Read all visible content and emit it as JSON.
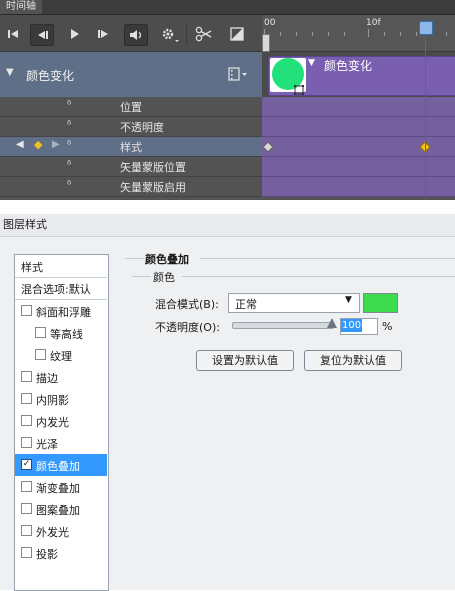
{
  "timeline": {
    "tab_title": "时间轴",
    "ruler": {
      "start_label": "00",
      "mark_label": "10f"
    },
    "layer": {
      "name": "颜色变化",
      "clip_name": "颜色变化"
    },
    "properties": [
      {
        "label": "位置"
      },
      {
        "label": "不透明度"
      },
      {
        "label": "样式"
      },
      {
        "label": "矢量蒙版位置"
      },
      {
        "label": "矢量蒙版启用"
      }
    ],
    "controls": {
      "first_frame_icon": "skip-to-first-icon",
      "prev_frame_icon": "previous-frame-icon",
      "play_icon": "play-icon",
      "next_frame_icon": "next-frame-icon",
      "audio_icon": "speaker-icon",
      "settings_icon": "gear-icon",
      "split_icon": "scissors-icon",
      "transition_icon": "transition-icon"
    },
    "colors": {
      "clip": "#7a5fb0",
      "playhead": "#e0302a",
      "keyframe": "#f0c020",
      "clip_thumb_circle": "#22e07a"
    }
  },
  "dialog": {
    "title": "图层样式",
    "left_panel": {
      "header": "样式",
      "blend_options": "混合选项:默认",
      "items": [
        {
          "label": "斜面和浮雕",
          "checked": false,
          "indent": false
        },
        {
          "label": "等高线",
          "checked": false,
          "indent": true
        },
        {
          "label": "纹理",
          "checked": false,
          "indent": true
        },
        {
          "label": "描边",
          "checked": false,
          "indent": false
        },
        {
          "label": "内阴影",
          "checked": false,
          "indent": false
        },
        {
          "label": "内发光",
          "checked": false,
          "indent": false
        },
        {
          "label": "光泽",
          "checked": false,
          "indent": false
        },
        {
          "label": "颜色叠加",
          "checked": true,
          "indent": false,
          "selected": true
        },
        {
          "label": "渐变叠加",
          "checked": false,
          "indent": false
        },
        {
          "label": "图案叠加",
          "checked": false,
          "indent": false
        },
        {
          "label": "外发光",
          "checked": false,
          "indent": false
        },
        {
          "label": "投影",
          "checked": false,
          "indent": false
        }
      ],
      "check_mark": "✓"
    },
    "section_title": "颜色叠加",
    "subsection_title": "颜色",
    "blend_mode_label": "混合模式(B):",
    "blend_mode_value": "正常",
    "opacity_label": "不透明度(O):",
    "opacity_value": "100",
    "opacity_unit": "%",
    "opacity_fraction": 1.0,
    "overlay_color": "#3ddc4f",
    "buttons": {
      "set_default": "设置为默认值",
      "reset_default": "复位为默认值"
    }
  }
}
